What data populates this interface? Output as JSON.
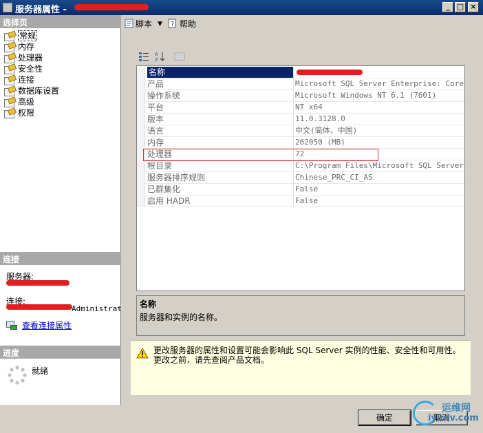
{
  "window": {
    "title": "服务器属性 -",
    "buttons": {
      "minimize": "_",
      "maximize": "□",
      "close": "×"
    }
  },
  "left": {
    "select_page_header": "选择页",
    "pages": [
      {
        "label": "常规",
        "selected": true
      },
      {
        "label": "内存",
        "selected": false
      },
      {
        "label": "处理器",
        "selected": false
      },
      {
        "label": "安全性",
        "selected": false
      },
      {
        "label": "连接",
        "selected": false
      },
      {
        "label": "数据库设置",
        "selected": false
      },
      {
        "label": "高级",
        "selected": false
      },
      {
        "label": "权限",
        "selected": false
      }
    ],
    "connection_header": "连接",
    "server_label": "服务器:",
    "connection_label": "连接:",
    "connection_value": "Administrat",
    "view_connection_link": "查看连接属性",
    "progress_header": "进度",
    "progress_status": "就绪"
  },
  "toolbar": {
    "script_label": "脚本",
    "help_label": "帮助"
  },
  "properties": [
    {
      "name": "名称",
      "value": ""
    },
    {
      "name": "产品",
      "value": "Microsoft SQL Server Enterprise: Core-bas"
    },
    {
      "name": "操作系统",
      "value": "Microsoft Windows NT 6.1 (7601)"
    },
    {
      "name": "平台",
      "value": "NT x64"
    },
    {
      "name": "版本",
      "value": "11.0.3128.0"
    },
    {
      "name": "语言",
      "value": "中文(简体，中国)"
    },
    {
      "name": "内存",
      "value": "262050 (MB)"
    },
    {
      "name": "处理器",
      "value": "72"
    },
    {
      "name": "根目录",
      "value": "C:\\Program Files\\Microsoft SQL Server\\MSS"
    },
    {
      "name": "服务器排序规则",
      "value": "Chinese_PRC_CI_AS"
    },
    {
      "name": "已群集化",
      "value": "False"
    },
    {
      "name": "启用 HADR",
      "value": "False"
    }
  ],
  "description": {
    "title": "名称",
    "text": "服务器和实例的名称。"
  },
  "warning": {
    "line1": "更改服务器的属性和设置可能会影响此 SQL Server 实例的性能、安全性和可用性。",
    "line2": "更改之前，请先查阅产品文档。"
  },
  "buttons": {
    "ok": "确定",
    "cancel": "取消"
  },
  "watermark": {
    "line1": "运维网",
    "line2": "iyunv.com"
  }
}
